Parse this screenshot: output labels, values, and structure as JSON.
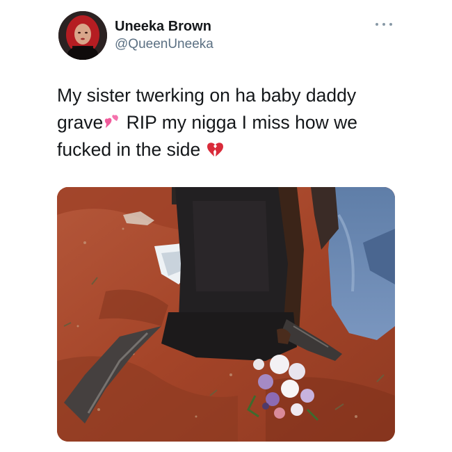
{
  "user": {
    "display_name": "Uneeka Brown",
    "handle": "@QueenUneeka",
    "avatar_icon": "profile-avatar"
  },
  "tweet": {
    "text_line1": "My sister twerking on ha baby daddy",
    "text_line2_a": "grave",
    "text_line2_b": " RIP my nigga I miss how we",
    "text_line3": "fucked in the side ",
    "emoji_1": "two-hearts-emoji",
    "emoji_2": "broken-heart-emoji"
  },
  "menu": {
    "icon": "more-icon"
  },
  "media": {
    "icon": "photo-media"
  },
  "colors": {
    "text": "#14171a",
    "secondary": "#5b7083",
    "dirt": "#a9472c",
    "pink": "#f05b9b",
    "red": "#d92b3a"
  }
}
